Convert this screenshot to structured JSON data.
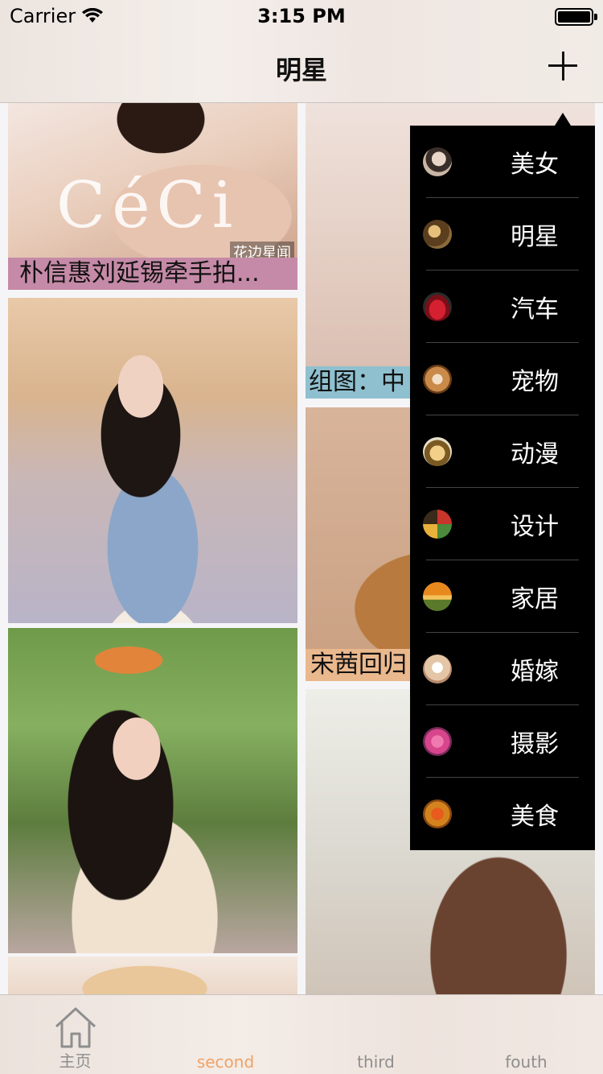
{
  "status_bar": {
    "carrier": "Carrier",
    "time": "3:15 PM"
  },
  "nav": {
    "title": "明星",
    "add_icon": "plus-icon"
  },
  "feed": {
    "left": [
      {
        "caption": "朴信惠刘延锡牵手拍...",
        "caption_color": "#c58aa7",
        "logo": "CéCi",
        "tag": "花边星闻"
      },
      {
        "caption": ""
      },
      {
        "caption": ""
      },
      {
        "caption": ""
      }
    ],
    "right": [
      {
        "caption": "组图：中",
        "caption_color": "#8fc0cf"
      },
      {
        "caption": "宋茜回归",
        "caption_color": "#eab88d"
      },
      {
        "caption": ""
      }
    ]
  },
  "menu": {
    "items": [
      {
        "label": "美女",
        "icon": "beauty-avatar-icon",
        "color": "#c9b6a5"
      },
      {
        "label": "明星",
        "icon": "star-avatar-icon",
        "color": "#8a6a3c"
      },
      {
        "label": "汽车",
        "icon": "car-avatar-icon",
        "color": "#c21f2a"
      },
      {
        "label": "宠物",
        "icon": "pet-avatar-icon",
        "color": "#c98a4a"
      },
      {
        "label": "动漫",
        "icon": "anime-avatar-icon",
        "color": "#7a5a22"
      },
      {
        "label": "设计",
        "icon": "design-avatar-icon",
        "color": "#c8352a"
      },
      {
        "label": "家居",
        "icon": "home-decor-avatar-icon",
        "color": "#e8891e"
      },
      {
        "label": "婚嫁",
        "icon": "wedding-avatar-icon",
        "color": "#e4c6a6"
      },
      {
        "label": "摄影",
        "icon": "photo-avatar-icon",
        "color": "#d7468c"
      },
      {
        "label": "美食",
        "icon": "food-avatar-icon",
        "color": "#d4821e"
      }
    ]
  },
  "tabs": [
    {
      "label": "主页",
      "icon": "home-icon",
      "active": false
    },
    {
      "label": "second",
      "active": true
    },
    {
      "label": "third",
      "active": false
    },
    {
      "label": "fouth",
      "active": false
    }
  ],
  "colors": {
    "active_tab": "#f1a266",
    "inactive_tab": "#8e8e8e",
    "menu_bg": "#000000"
  }
}
